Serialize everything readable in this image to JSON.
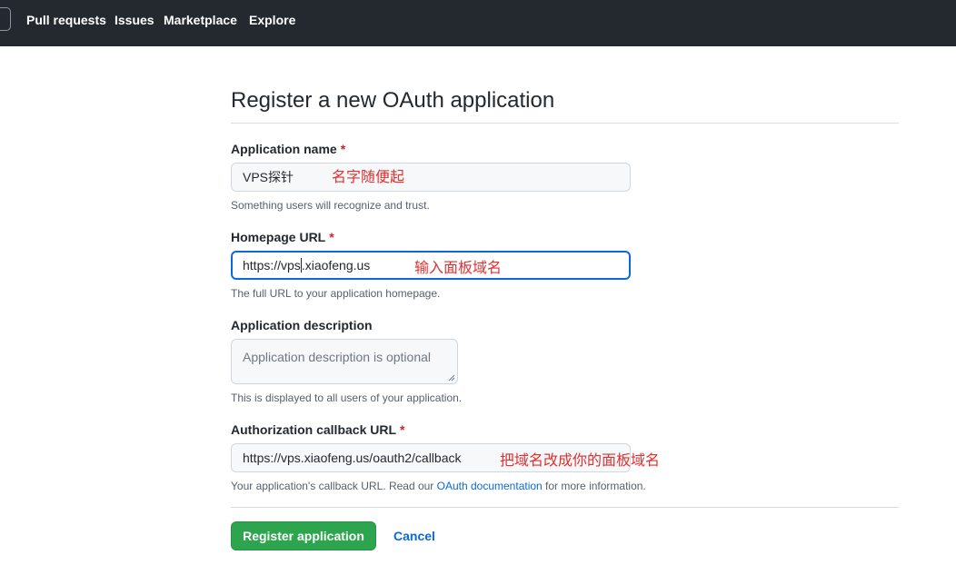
{
  "nav": {
    "items": [
      {
        "label": "Pull requests"
      },
      {
        "label": "Issues"
      },
      {
        "label": "Marketplace"
      },
      {
        "label": "Explore"
      }
    ]
  },
  "page": {
    "title": "Register a new OAuth application"
  },
  "form": {
    "app_name": {
      "label": "Application name",
      "required_mark": "*",
      "value": "VPS探针",
      "note": "Something users will recognize and trust."
    },
    "homepage_url": {
      "label": "Homepage URL",
      "required_mark": "*",
      "value_before_caret": "https://vps",
      "value_after_caret": ".xiaofeng.us",
      "note": "The full URL to your application homepage."
    },
    "description": {
      "label": "Application description",
      "placeholder": "Application description is optional",
      "note": "This is displayed to all users of your application."
    },
    "callback_url": {
      "label": "Authorization callback URL",
      "required_mark": "*",
      "value": "https://vps.xiaofeng.us/oauth2/callback",
      "note_before": "Your application's callback URL. Read our ",
      "note_link": "OAuth documentation",
      "note_after": " for more information."
    }
  },
  "annotations": {
    "name_hint": "名字随便起",
    "homepage_hint": "输入面板域名",
    "callback_hint": "把域名改成你的面板域名"
  },
  "actions": {
    "register_label": "Register application",
    "cancel_label": "Cancel"
  },
  "colors": {
    "header_bg": "#24292f",
    "primary_button": "#2da44e",
    "link": "#0969da",
    "required": "#cf222e",
    "annotation": "#e03030",
    "focus_border": "#0969da"
  }
}
